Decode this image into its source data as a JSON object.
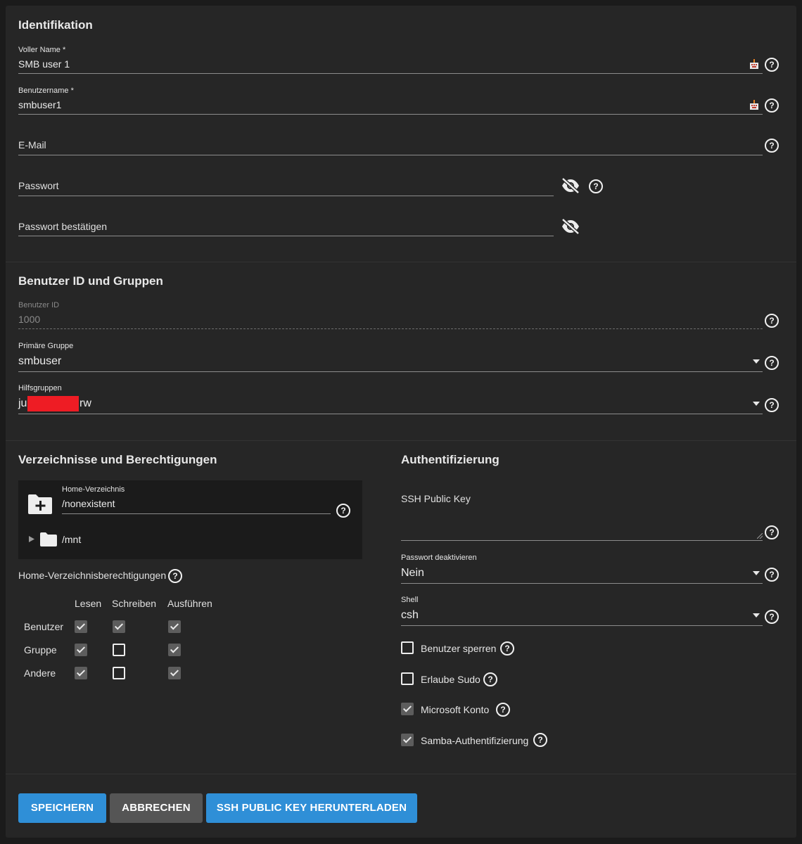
{
  "identification": {
    "title": "Identifikation",
    "full_name_label": "Voller Name *",
    "full_name_value": "SMB user 1",
    "username_label": "Benutzername *",
    "username_value": "smbuser1",
    "email_placeholder": "E-Mail",
    "password_placeholder": "Passwort",
    "password_confirm_placeholder": "Passwort bestätigen"
  },
  "user_groups": {
    "title": "Benutzer ID und Gruppen",
    "user_id_label": "Benutzer ID",
    "user_id_value": "1000",
    "primary_group_label": "Primäre Gruppe",
    "primary_group_value": "smbuser",
    "aux_groups_label": "Hilfsgruppen",
    "aux_groups_prefix": "ju",
    "aux_groups_suffix": "rw"
  },
  "directories": {
    "title": "Verzeichnisse und Berechtigungen",
    "home_label": "Home-Verzeichnis",
    "home_value": "/nonexistent",
    "tree_item": "/mnt",
    "permissions_label": "Home-Verzeichnisberechtigungen",
    "columns": [
      "Lesen",
      "Schreiben",
      "Ausführen"
    ],
    "rows": [
      {
        "label": "Benutzer",
        "read": true,
        "write": true,
        "execute": true
      },
      {
        "label": "Gruppe",
        "read": true,
        "write": false,
        "execute": true
      },
      {
        "label": "Andere",
        "read": true,
        "write": false,
        "execute": true
      }
    ]
  },
  "authentication": {
    "title": "Authentifizierung",
    "ssh_key_placeholder": "SSH Public Key",
    "disable_password_label": "Passwort deaktivieren",
    "disable_password_value": "Nein",
    "shell_label": "Shell",
    "shell_value": "csh",
    "options": [
      {
        "label": "Benutzer sperren",
        "checked": false
      },
      {
        "label": "Erlaube Sudo",
        "checked": false
      },
      {
        "label": "Microsoft Konto",
        "checked": true
      },
      {
        "label": "Samba-Authentifizierung",
        "checked": true
      }
    ]
  },
  "actions": {
    "save": "SPEICHERN",
    "cancel": "ABBRECHEN",
    "download_key": "SSH PUBLIC KEY HERUNTERLADEN"
  },
  "colors": {
    "background": "#1b1b1b",
    "card": "#262626",
    "primary_button": "#2f8fd7",
    "secondary_button": "#555555",
    "redaction": "#ee1c24"
  }
}
